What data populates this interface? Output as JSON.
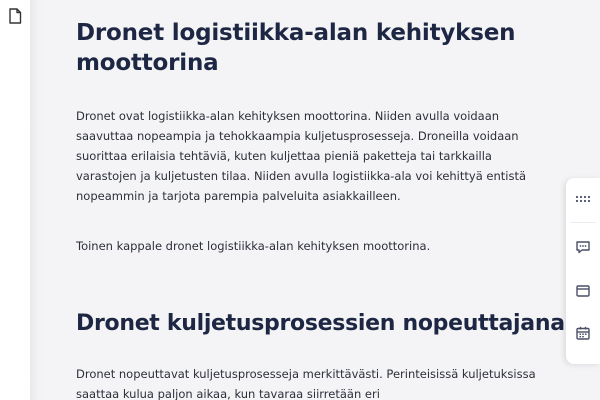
{
  "sidebar": {
    "icon": "document-icon"
  },
  "article": {
    "heading1": "Dronet logistiikka-alan kehityksen moottorina",
    "paragraph1": "Dronet ovat logistiikka-alan kehityksen moottorina. Niiden avulla voidaan saavuttaa nopeampia ja tehokkaampia kuljetusprosesseja. Droneilla voidaan suorittaa erilaisia tehtäviä, kuten kuljettaa pieniä paketteja tai tarkkailla varastojen ja kuljetusten tilaa. Niiden avulla logistiikka-ala voi kehittyä entistä nopeammin ja tarjota parempia palveluita asiakkailleen.",
    "paragraph2": "Toinen kappale dronet logistiikka-alan kehityksen moottorina.",
    "heading2": "Dronet kuljetusprosessien nopeuttajana",
    "paragraph3": "Dronet nopeuttavat kuljetusprosesseja merkittävästi. Perinteisissä kuljetuksissa saattaa kulua paljon aikaa, kun tavaraa siirretään eri"
  },
  "widget": {
    "icons": [
      "grid-dots-icon",
      "chat-icon",
      "browser-window-icon",
      "calendar-icon"
    ]
  },
  "colors": {
    "heading": "#1d2743",
    "text": "#2c2f3a",
    "background": "#f4f4f6"
  }
}
